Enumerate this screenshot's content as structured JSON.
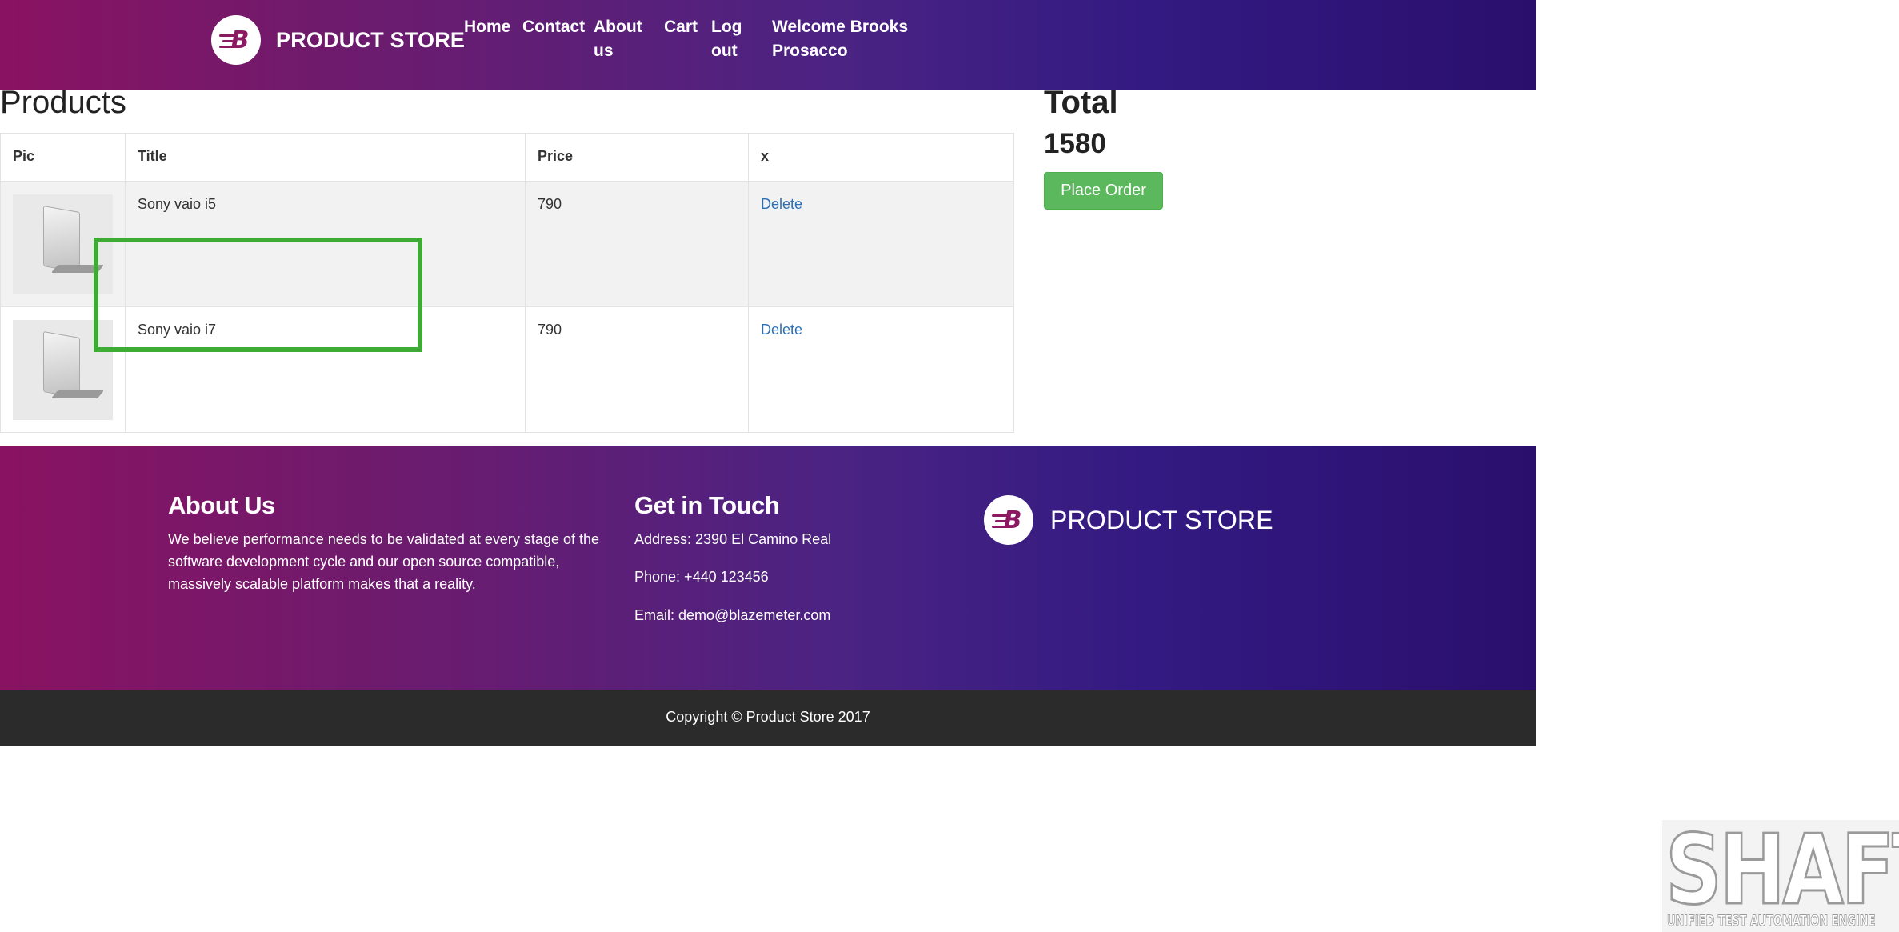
{
  "navbar": {
    "brand": "PRODUCT STORE",
    "links": [
      "Home",
      "Contact",
      "About us",
      "Cart",
      "Log out"
    ],
    "welcome": "Welcome Brooks Prosacco"
  },
  "products": {
    "heading": "Products",
    "columns": [
      "Pic",
      "Title",
      "Price",
      "x"
    ],
    "rows": [
      {
        "title": "Sony vaio i5",
        "price": "790",
        "action": "Delete"
      },
      {
        "title": "Sony vaio i7",
        "price": "790",
        "action": "Delete"
      }
    ]
  },
  "summary": {
    "heading": "Total",
    "total": "1580",
    "button": "Place Order"
  },
  "footer": {
    "about_heading": "About Us",
    "about_text": "We believe performance needs to be validated at every stage of the software development cycle and our open source compatible, massively scalable platform makes that a reality.",
    "contact_heading": "Get in Touch",
    "address": "Address: 2390 El Camino Real",
    "phone": "Phone: +440 123456",
    "email": "Email: demo@blazemeter.com",
    "brand": "PRODUCT STORE",
    "copyright": "Copyright © Product Store 2017"
  },
  "watermark": {
    "main": "SHAFT",
    "sub": "UNIFIED TEST AUTOMATION ENGINE"
  },
  "colors": {
    "gradient_start": "#8a1262",
    "gradient_end": "#2b0f6d",
    "button": "#5cb85c",
    "link": "#2e6fb5",
    "highlight": "#3eab34"
  }
}
